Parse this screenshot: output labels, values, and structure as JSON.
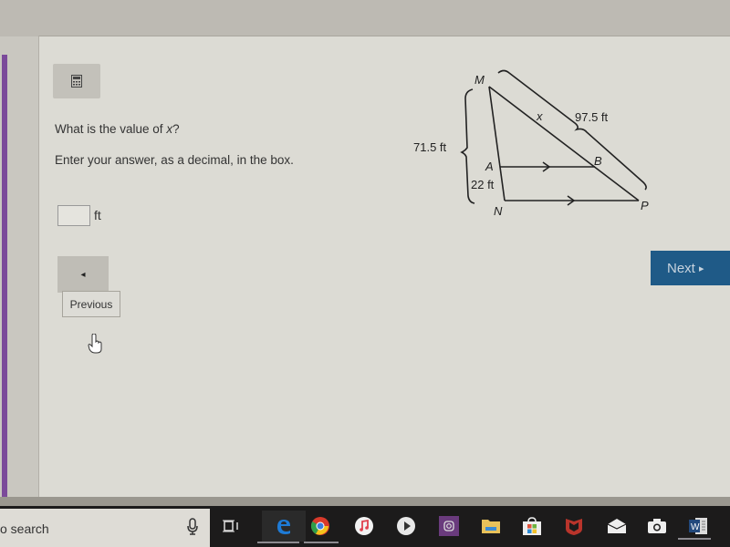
{
  "question": {
    "prompt_prefix": "What is the value of ",
    "prompt_var": "x",
    "prompt_suffix": "?",
    "instruction": "Enter your answer, as a decimal, in the box.",
    "answer_value": "",
    "answer_unit": "ft"
  },
  "diagram": {
    "vertices": {
      "M": "M",
      "A": "A",
      "N": "N",
      "B": "B",
      "P": "P"
    },
    "labels": {
      "mn_length": "71.5 ft",
      "an_length": "22 ft",
      "mp_length": "97.5 ft",
      "mb_var": "x"
    }
  },
  "nav": {
    "previous_tooltip": "Previous",
    "next_label": "Next",
    "next_arrow": "▸",
    "previous_arrow": "◂"
  },
  "taskbar": {
    "search_text": "o search",
    "icons": [
      "mic-icon",
      "task-view-icon",
      "edge-icon",
      "chrome-icon",
      "itunes-icon",
      "media-player-icon",
      "instagram-icon",
      "file-explorer-icon",
      "store-icon",
      "mcafee-icon",
      "mail-icon",
      "camera-icon",
      "word-icon"
    ]
  },
  "colors": {
    "next_button": "#1f5a87",
    "accent_purple": "#7b4a9a"
  }
}
